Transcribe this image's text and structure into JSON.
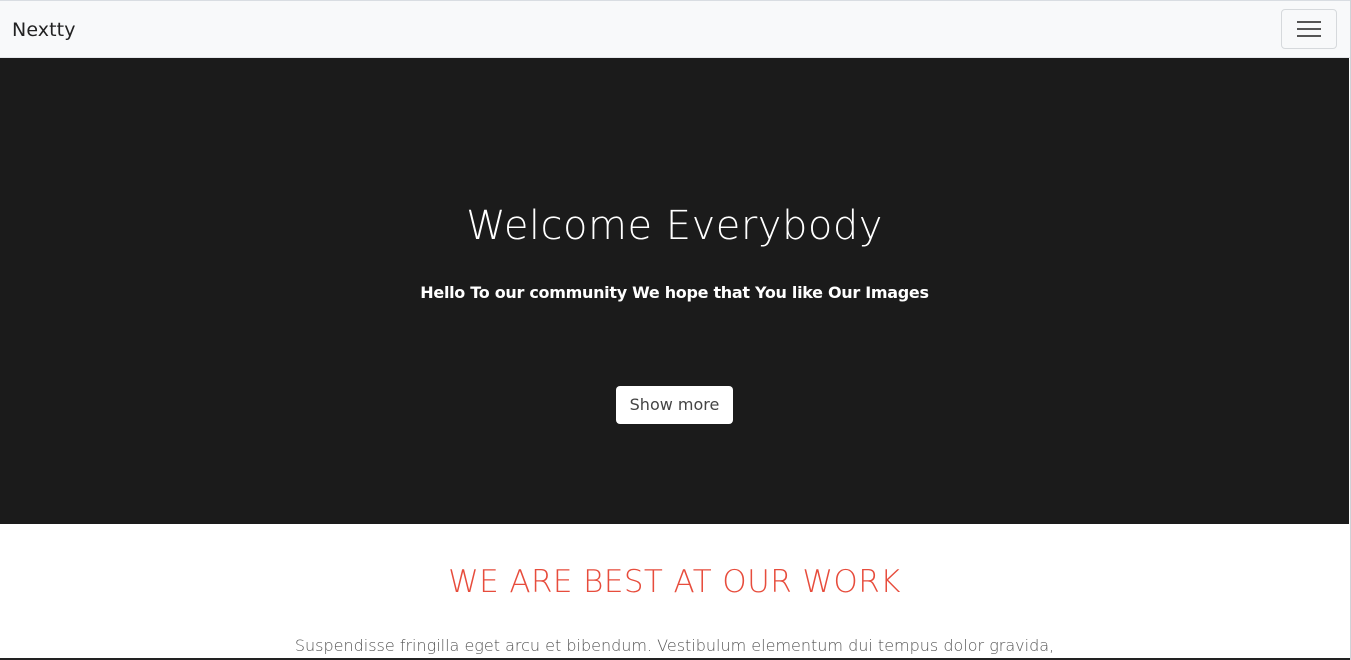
{
  "navbar": {
    "brand": "Nextty",
    "toggler_icon": "hamburger-menu-icon"
  },
  "hero": {
    "title": "Welcome Everybody",
    "subtitle": "Hello To our community We hope that You like Our Images",
    "button_label": "Show more"
  },
  "about": {
    "heading": "WE ARE BEST AT OUR WORK",
    "text": "Suspendisse fringilla eget arcu et bibendum. Vestibulum elementum dui tempus dolor gravida,"
  },
  "colors": {
    "navbar_bg": "#f8f9fa",
    "hero_bg": "#1b1b1b",
    "accent": "#e74c3c"
  }
}
